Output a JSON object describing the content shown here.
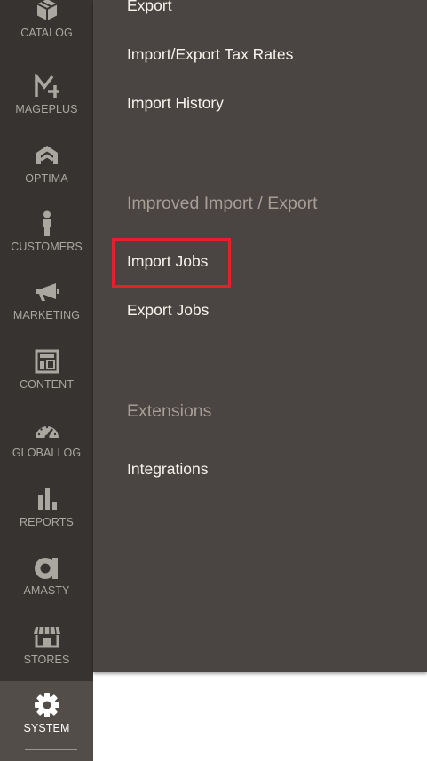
{
  "sidebar": {
    "items": [
      {
        "label": "CATALOG",
        "icon": "catalog-box-icon"
      },
      {
        "label": "MAGEPLUS",
        "icon": "mageplus-logo-icon"
      },
      {
        "label": "OPTIMA",
        "icon": "optima-logo-icon"
      },
      {
        "label": "CUSTOMERS",
        "icon": "customer-person-icon"
      },
      {
        "label": "MARKETING",
        "icon": "megaphone-icon"
      },
      {
        "label": "CONTENT",
        "icon": "content-layout-icon"
      },
      {
        "label": "GLOBALLOG",
        "icon": "speedometer-icon"
      },
      {
        "label": "REPORTS",
        "icon": "bar-chart-icon"
      },
      {
        "label": "AMASTY",
        "icon": "amasty-logo-icon"
      },
      {
        "label": "STORES",
        "icon": "storefront-icon"
      },
      {
        "label": "SYSTEM",
        "icon": "gear-icon",
        "active": true
      }
    ]
  },
  "submenu": {
    "data_transfer_links": [
      "Export",
      "Import/Export Tax Rates",
      "Import History"
    ],
    "improved_section": {
      "title": "Improved Import / Export",
      "links": [
        "Import Jobs",
        "Export Jobs"
      ]
    },
    "extensions_section": {
      "title": "Extensions",
      "links": [
        "Integrations"
      ]
    },
    "highlighted_item": "Import Jobs"
  },
  "colors": {
    "sidebar_bg": "#373330",
    "sidebar_active_bg": "#524d49",
    "submenu_bg": "#4a4542",
    "link_text": "#f7f3eb",
    "section_title": "#a79d95",
    "highlight_border": "#e4202a"
  }
}
